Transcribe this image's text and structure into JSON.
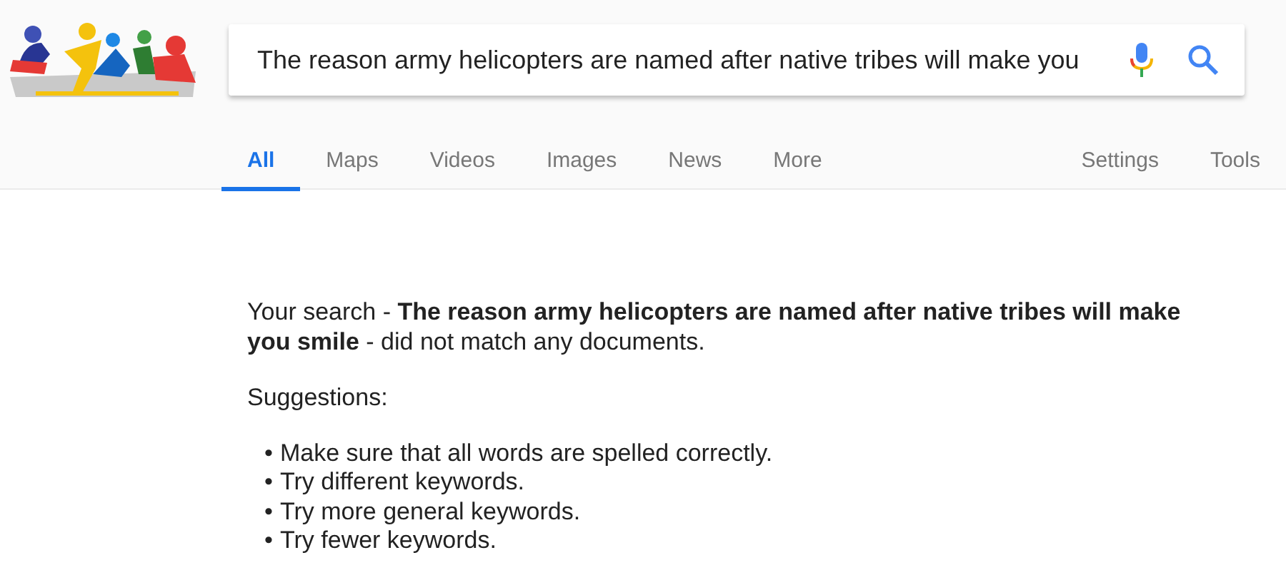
{
  "search": {
    "value": "The reason army helicopters are named after native tribes will make you"
  },
  "tabs": [
    {
      "label": "All",
      "selected": true
    },
    {
      "label": "Maps",
      "selected": false
    },
    {
      "label": "Videos",
      "selected": false
    },
    {
      "label": "Images",
      "selected": false
    },
    {
      "label": "News",
      "selected": false
    },
    {
      "label": "More",
      "selected": false
    }
  ],
  "tools": [
    "Settings",
    "Tools"
  ],
  "message": "Your search - **The reason army helicopters are named after native tribes will make you smile** - did not match any documents.",
  "suggestions_label": "Suggestions:",
  "suggestions": [
    {
      "bullet": "•",
      "text": "Make sure that all words are spelled correctly."
    },
    {
      "bullet": "•",
      "text": "Try different keywords."
    },
    {
      "bullet": "•",
      "text": "Try more general keywords."
    },
    {
      "bullet": "•",
      "text": "Try fewer keywords."
    }
  ]
}
